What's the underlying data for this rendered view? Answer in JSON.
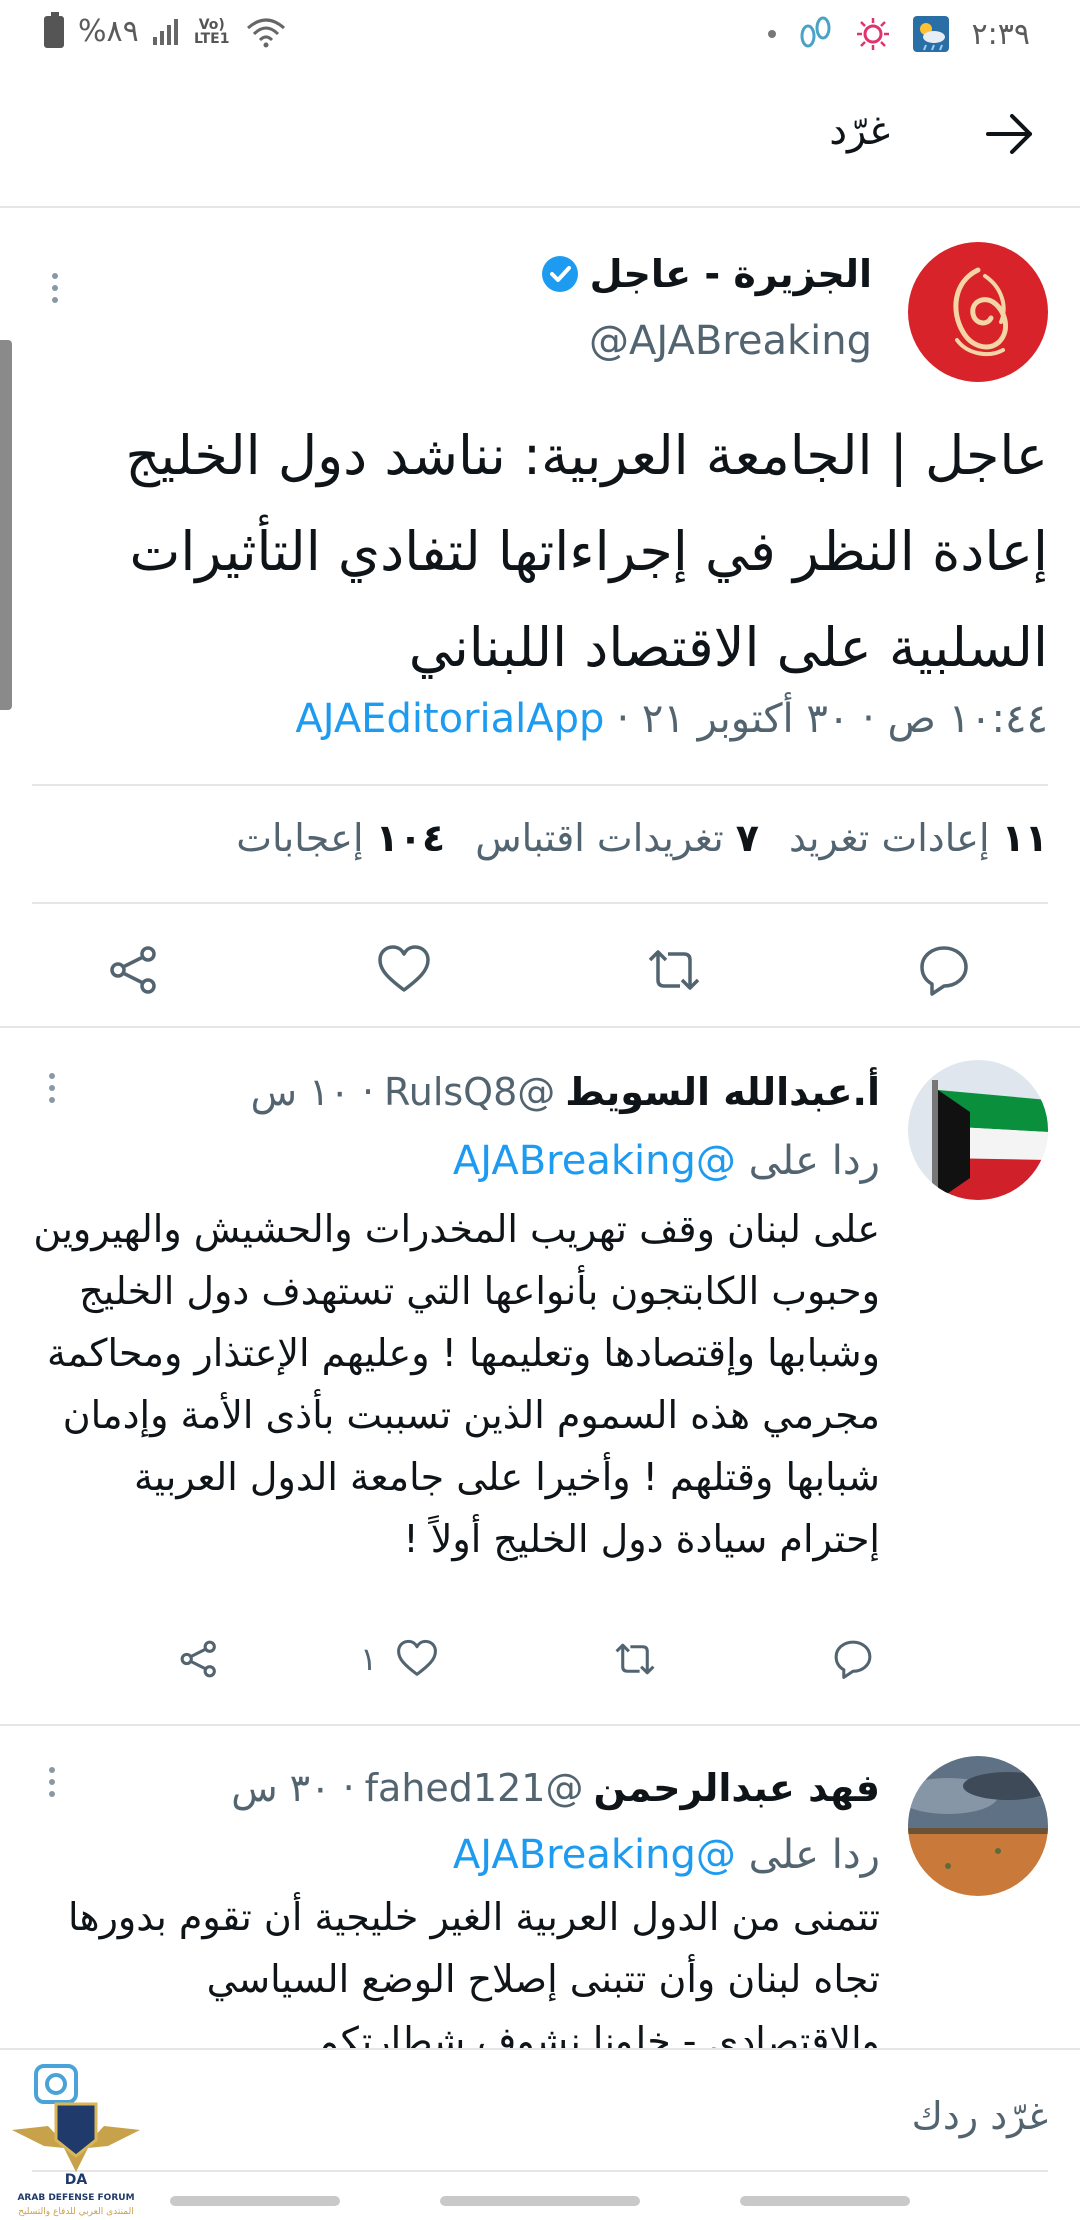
{
  "status_bar": {
    "battery_text": "%٨٩",
    "network": "Vo) LTE1",
    "time": "٢:٣٩"
  },
  "header": {
    "title": "غرّد"
  },
  "main_tweet": {
    "author_name": "الجزيرة - عاجل",
    "handle": "@AJABreaking",
    "text": "عاجل | الجامعة العربية: نناشد دول الخليج إعادة النظر في إجراءاتها لتفادي التأثيرات السلبية على الاقتصاد اللبناني",
    "time": "١٠:٤٤ ص · ٣٠ أكتوبر ٢١ ·",
    "source": "AJAEditorialApp",
    "stats": {
      "retweets_count": "١١",
      "retweets_label": "إعادات تغريد",
      "quotes_count": "٧",
      "quotes_label": "تغريدات اقتباس",
      "likes_count": "١٠٤",
      "likes_label": "إعجابات"
    }
  },
  "replies": [
    {
      "name": "أ.عبدالله السويط",
      "handle": "@RulsQ8",
      "time": "· ١٠ س",
      "reply_to_label": "ردا على",
      "reply_to_handle": "@AJABreaking",
      "text": "على لبنان وقف تهريب المخدرات والحشيش والهيروين وحبوب الكابتجون بأنواعها التي تستهدف دول الخليج وشبابها وإقتصادها وتعليمها ! وعليهم الإعتذار ومحاكمة مجرمي هذه السموم الذين تسببت بأذى الأمة وإدمان شبابها وقتلهم ! وأخيرا على جامعة الدول العربية إحترام سيادة دول الخليج أولاً !",
      "like_count": "١"
    },
    {
      "name": "فهد عبدالرحمن",
      "handle": "@fahed121",
      "time": "· ٣٠ س",
      "reply_to_label": "ردا على",
      "reply_to_handle": "@AJABreaking",
      "text": "تتمنى من الدول العربية الغير خليجية  أن تقوم بدورها تجاه لبنان وأن تتبنى إصلاح الوضع السياسي والاقتصادي - خلونا نشوف شطارتكم ."
    }
  ],
  "compose": {
    "placeholder": "غرّد ردك"
  },
  "watermark": {
    "line1": "ARAB DEFENSE FORUM",
    "line2": "المنتدى العربي للدفاع والتسليح"
  },
  "colors": {
    "accent": "#1d9bf0",
    "aljazeera_red": "#d8232a",
    "secondary_text": "#536471"
  }
}
